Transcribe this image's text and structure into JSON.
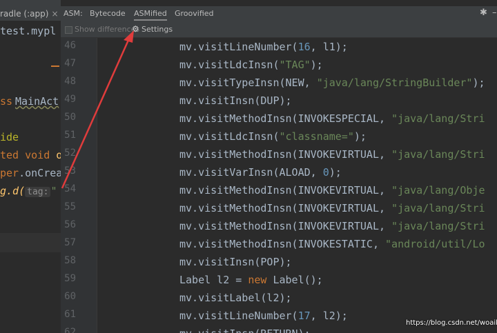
{
  "left_editor": {
    "tab_label": "radle (:app)",
    "tab_close": "×",
    "lines": [
      {
        "text": "test.mypl",
        "type": "plain"
      },
      {
        "text": "ss MainAct",
        "type": "class"
      },
      {
        "text": "ide",
        "type": "ann"
      },
      {
        "text": "ted void o",
        "type": "method"
      },
      {
        "text": "per.onCrea",
        "type": "call"
      },
      {
        "text": "g.d(",
        "hint": "tag:",
        "tail": "\"",
        "type": "log"
      }
    ]
  },
  "asm_bar": {
    "label": "ASM:",
    "tabs": [
      "Bytecode",
      "ASMified",
      "Groovified"
    ],
    "active_tab": "ASMified",
    "settings_icon": "gear-icon",
    "minimize_icon": "minimize-icon"
  },
  "toolbar": {
    "show_differences": "Show differences",
    "settings": "Settings"
  },
  "code_lines": [
    {
      "n": "46",
      "parts": [
        [
          "p",
          "mv.visitLineNumber("
        ],
        [
          "n",
          "16"
        ],
        [
          "p",
          ", l1);"
        ]
      ]
    },
    {
      "n": "47",
      "parts": [
        [
          "p",
          "mv.visitLdcInsn("
        ],
        [
          "s",
          "\"TAG\""
        ],
        [
          "p",
          ");"
        ]
      ]
    },
    {
      "n": "48",
      "parts": [
        [
          "p",
          "mv.visitTypeInsn(NEW, "
        ],
        [
          "s",
          "\"java/lang/StringBuilder\""
        ],
        [
          "p",
          ");"
        ]
      ]
    },
    {
      "n": "49",
      "parts": [
        [
          "p",
          "mv.visitInsn(DUP);"
        ]
      ]
    },
    {
      "n": "50",
      "parts": [
        [
          "p",
          "mv.visitMethodInsn(INVOKESPECIAL, "
        ],
        [
          "s",
          "\"java/lang/Stri"
        ]
      ]
    },
    {
      "n": "51",
      "parts": [
        [
          "p",
          "mv.visitLdcInsn("
        ],
        [
          "s",
          "\"classname=\""
        ],
        [
          "p",
          ");"
        ]
      ]
    },
    {
      "n": "52",
      "parts": [
        [
          "p",
          "mv.visitMethodInsn(INVOKEVIRTUAL, "
        ],
        [
          "s",
          "\"java/lang/Stri"
        ]
      ]
    },
    {
      "n": "53",
      "parts": [
        [
          "p",
          "mv.visitVarInsn(ALOAD, "
        ],
        [
          "n",
          "0"
        ],
        [
          "p",
          ");"
        ]
      ]
    },
    {
      "n": "54",
      "parts": [
        [
          "p",
          "mv.visitMethodInsn(INVOKEVIRTUAL, "
        ],
        [
          "s",
          "\"java/lang/Obje"
        ]
      ]
    },
    {
      "n": "55",
      "parts": [
        [
          "p",
          "mv.visitMethodInsn(INVOKEVIRTUAL, "
        ],
        [
          "s",
          "\"java/lang/Stri"
        ]
      ]
    },
    {
      "n": "56",
      "parts": [
        [
          "p",
          "mv.visitMethodInsn(INVOKEVIRTUAL, "
        ],
        [
          "s",
          "\"java/lang/Stri"
        ]
      ]
    },
    {
      "n": "57",
      "parts": [
        [
          "p",
          "mv.visitMethodInsn(INVOKESTATIC, "
        ],
        [
          "s",
          "\"android/util/Lo"
        ]
      ]
    },
    {
      "n": "58",
      "parts": [
        [
          "p",
          "mv.visitInsn(POP);"
        ]
      ]
    },
    {
      "n": "59",
      "parts": [
        [
          "p",
          "Label l2 = "
        ],
        [
          "k",
          "new"
        ],
        [
          "p",
          " Label();"
        ]
      ]
    },
    {
      "n": "60",
      "parts": [
        [
          "p",
          "mv.visitLabel(l2);"
        ]
      ]
    },
    {
      "n": "61",
      "parts": [
        [
          "p",
          "mv.visitLineNumber("
        ],
        [
          "n",
          "17"
        ],
        [
          "p",
          ", l2);"
        ]
      ]
    },
    {
      "n": "62",
      "parts": [
        [
          "p",
          "mv.visitInsn(RETURN);"
        ]
      ]
    }
  ],
  "watermark": "https://blog.csdn.net/woailiqy",
  "colors": {
    "background": "#2b2b2b",
    "string": "#6a8759",
    "number": "#6897bb",
    "keyword": "#cc7832",
    "arrow": "#e03c3c"
  }
}
